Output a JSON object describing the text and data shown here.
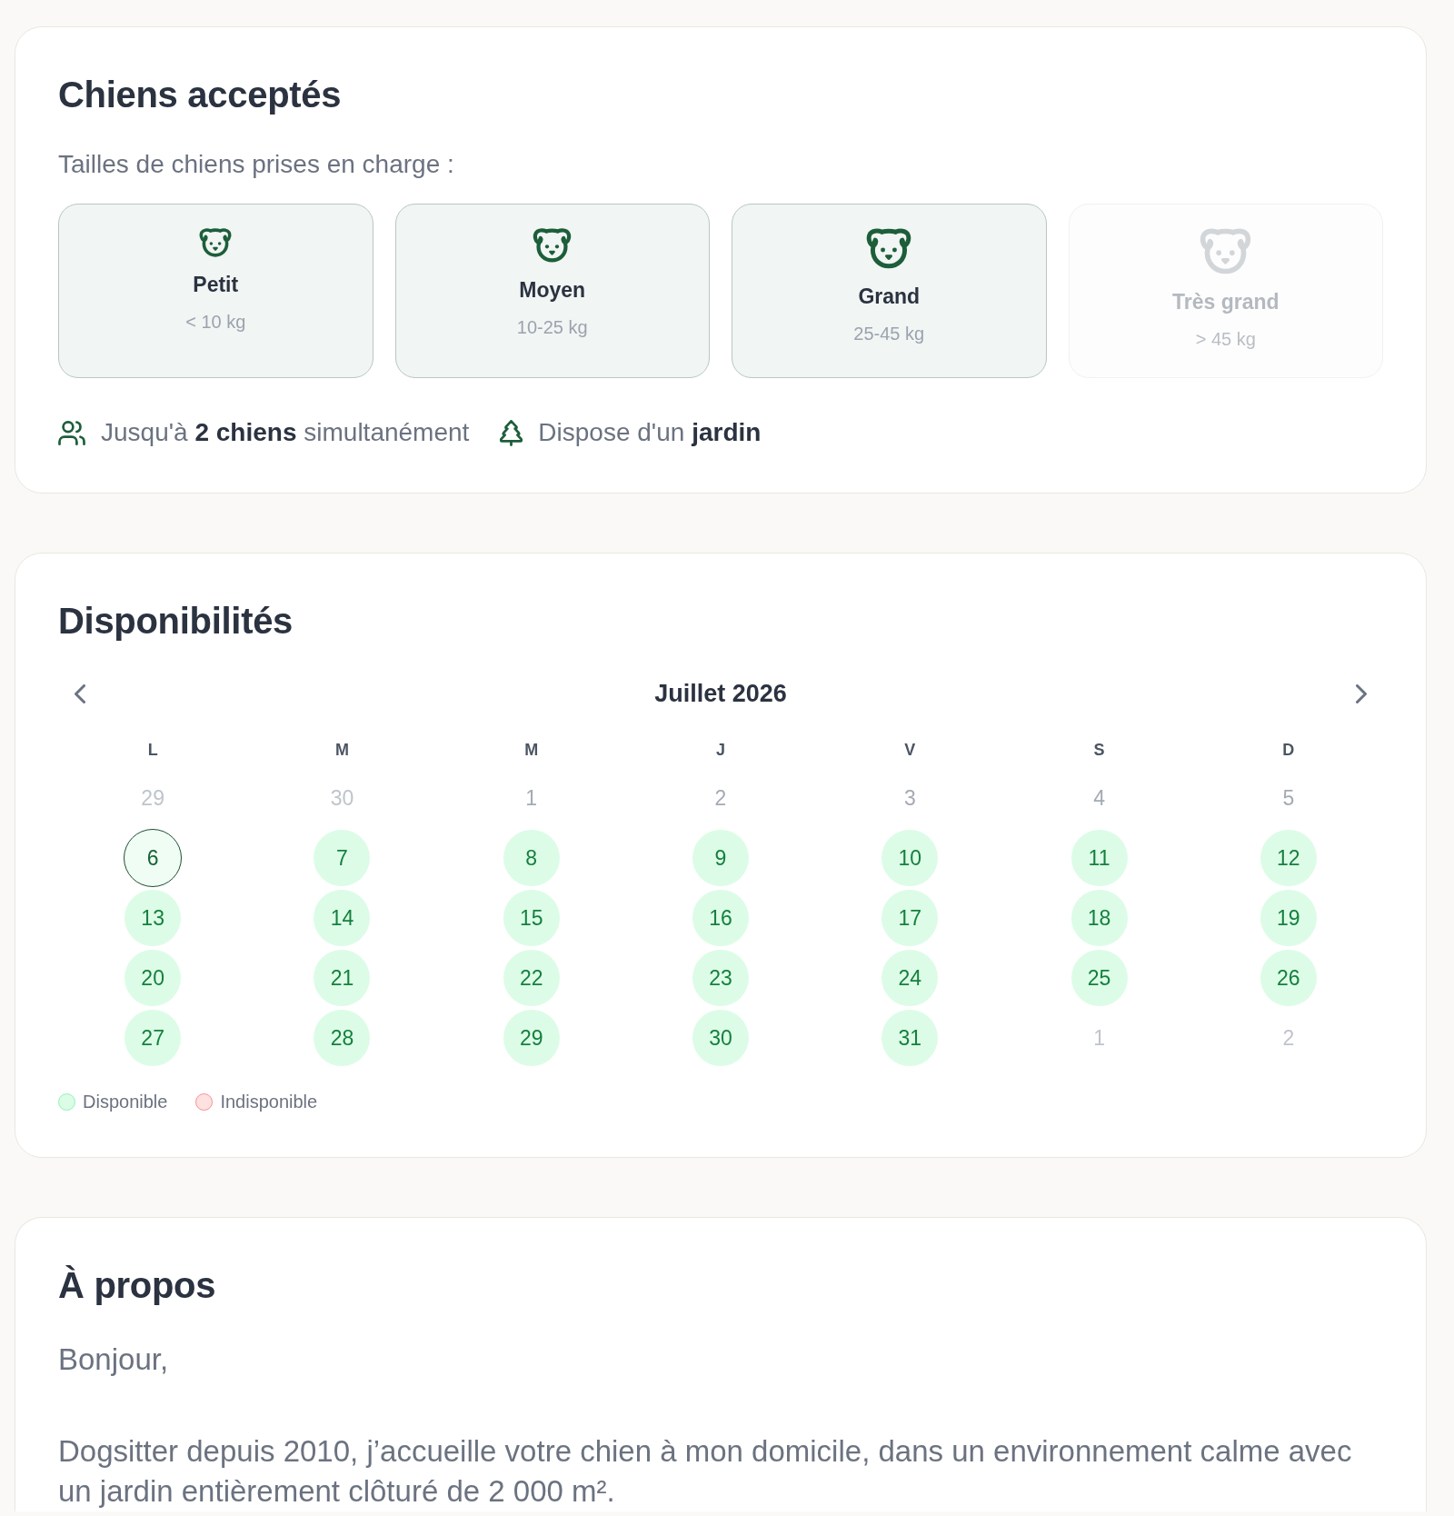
{
  "accepted_dogs": {
    "title": "Chiens acceptés",
    "subtitle": "Tailles de chiens prises en charge :",
    "sizes": [
      {
        "label": "Petit",
        "weight": "< 10 kg",
        "accepted": true
      },
      {
        "label": "Moyen",
        "weight": "10-25 kg",
        "accepted": true
      },
      {
        "label": "Grand",
        "weight": "25-45 kg",
        "accepted": true
      },
      {
        "label": "Très grand",
        "weight": "> 45 kg",
        "accepted": false
      }
    ],
    "facts": [
      {
        "kind": "dogs",
        "text": "Jusqu'à **2 chiens** simultanément"
      },
      {
        "kind": "garden",
        "text": "Dispose d'un **jardin**"
      }
    ]
  },
  "availability": {
    "title": "Disponibilités",
    "calendar": {
      "month": "Juillet 2026",
      "weekdays": [
        "L",
        "M",
        "M",
        "J",
        "V",
        "S",
        "D"
      ],
      "days": [
        {
          "label": "29",
          "outside": true,
          "disabled": true,
          "today": false
        },
        {
          "label": "30",
          "outside": true,
          "disabled": true,
          "today": false
        },
        {
          "label": "1",
          "outside": false,
          "disabled": true,
          "today": false
        },
        {
          "label": "2",
          "outside": false,
          "disabled": true,
          "today": false
        },
        {
          "label": "3",
          "outside": false,
          "disabled": true,
          "today": false
        },
        {
          "label": "4",
          "outside": false,
          "disabled": true,
          "today": false
        },
        {
          "label": "5",
          "outside": false,
          "disabled": true,
          "today": false
        },
        {
          "label": "6",
          "outside": false,
          "disabled": false,
          "today": true
        },
        {
          "label": "7",
          "outside": false,
          "disabled": false,
          "today": false
        },
        {
          "label": "8",
          "outside": false,
          "disabled": false,
          "today": false
        },
        {
          "label": "9",
          "outside": false,
          "disabled": false,
          "today": false
        },
        {
          "label": "10",
          "outside": false,
          "disabled": false,
          "today": false
        },
        {
          "label": "11",
          "outside": false,
          "disabled": false,
          "today": false
        },
        {
          "label": "12",
          "outside": false,
          "disabled": false,
          "today": false
        },
        {
          "label": "13",
          "outside": false,
          "disabled": false,
          "today": false
        },
        {
          "label": "14",
          "outside": false,
          "disabled": false,
          "today": false
        },
        {
          "label": "15",
          "outside": false,
          "disabled": false,
          "today": false
        },
        {
          "label": "16",
          "outside": false,
          "disabled": false,
          "today": false
        },
        {
          "label": "17",
          "outside": false,
          "disabled": false,
          "today": false
        },
        {
          "label": "18",
          "outside": false,
          "disabled": false,
          "today": false
        },
        {
          "label": "19",
          "outside": false,
          "disabled": false,
          "today": false
        },
        {
          "label": "20",
          "outside": false,
          "disabled": false,
          "today": false
        },
        {
          "label": "21",
          "outside": false,
          "disabled": false,
          "today": false
        },
        {
          "label": "22",
          "outside": false,
          "disabled": false,
          "today": false
        },
        {
          "label": "23",
          "outside": false,
          "disabled": false,
          "today": false
        },
        {
          "label": "24",
          "outside": false,
          "disabled": false,
          "today": false
        },
        {
          "label": "25",
          "outside": false,
          "disabled": false,
          "today": false
        },
        {
          "label": "26",
          "outside": false,
          "disabled": false,
          "today": false
        },
        {
          "label": "27",
          "outside": false,
          "disabled": false,
          "today": false
        },
        {
          "label": "28",
          "outside": false,
          "disabled": false,
          "today": false
        },
        {
          "label": "29",
          "outside": false,
          "disabled": false,
          "today": false
        },
        {
          "label": "30",
          "outside": false,
          "disabled": false,
          "today": false
        },
        {
          "label": "31",
          "outside": false,
          "disabled": false,
          "today": false
        },
        {
          "label": "1",
          "outside": true,
          "disabled": true,
          "today": false
        },
        {
          "label": "2",
          "outside": true,
          "disabled": true,
          "today": false
        }
      ],
      "legend": [
        {
          "label": "Disponible",
          "color": "#dcfce7"
        },
        {
          "label": "Indisponible",
          "color": "#fee2e2"
        }
      ]
    }
  },
  "about": {
    "title": "À propos",
    "paragraphs": [
      "Bonjour,",
      "Dogsitter depuis 2010, j’accueille votre chien à mon domicile, dans un environnement calme avec un jardin entièrement clôturé de 2 000 m²."
    ]
  }
}
